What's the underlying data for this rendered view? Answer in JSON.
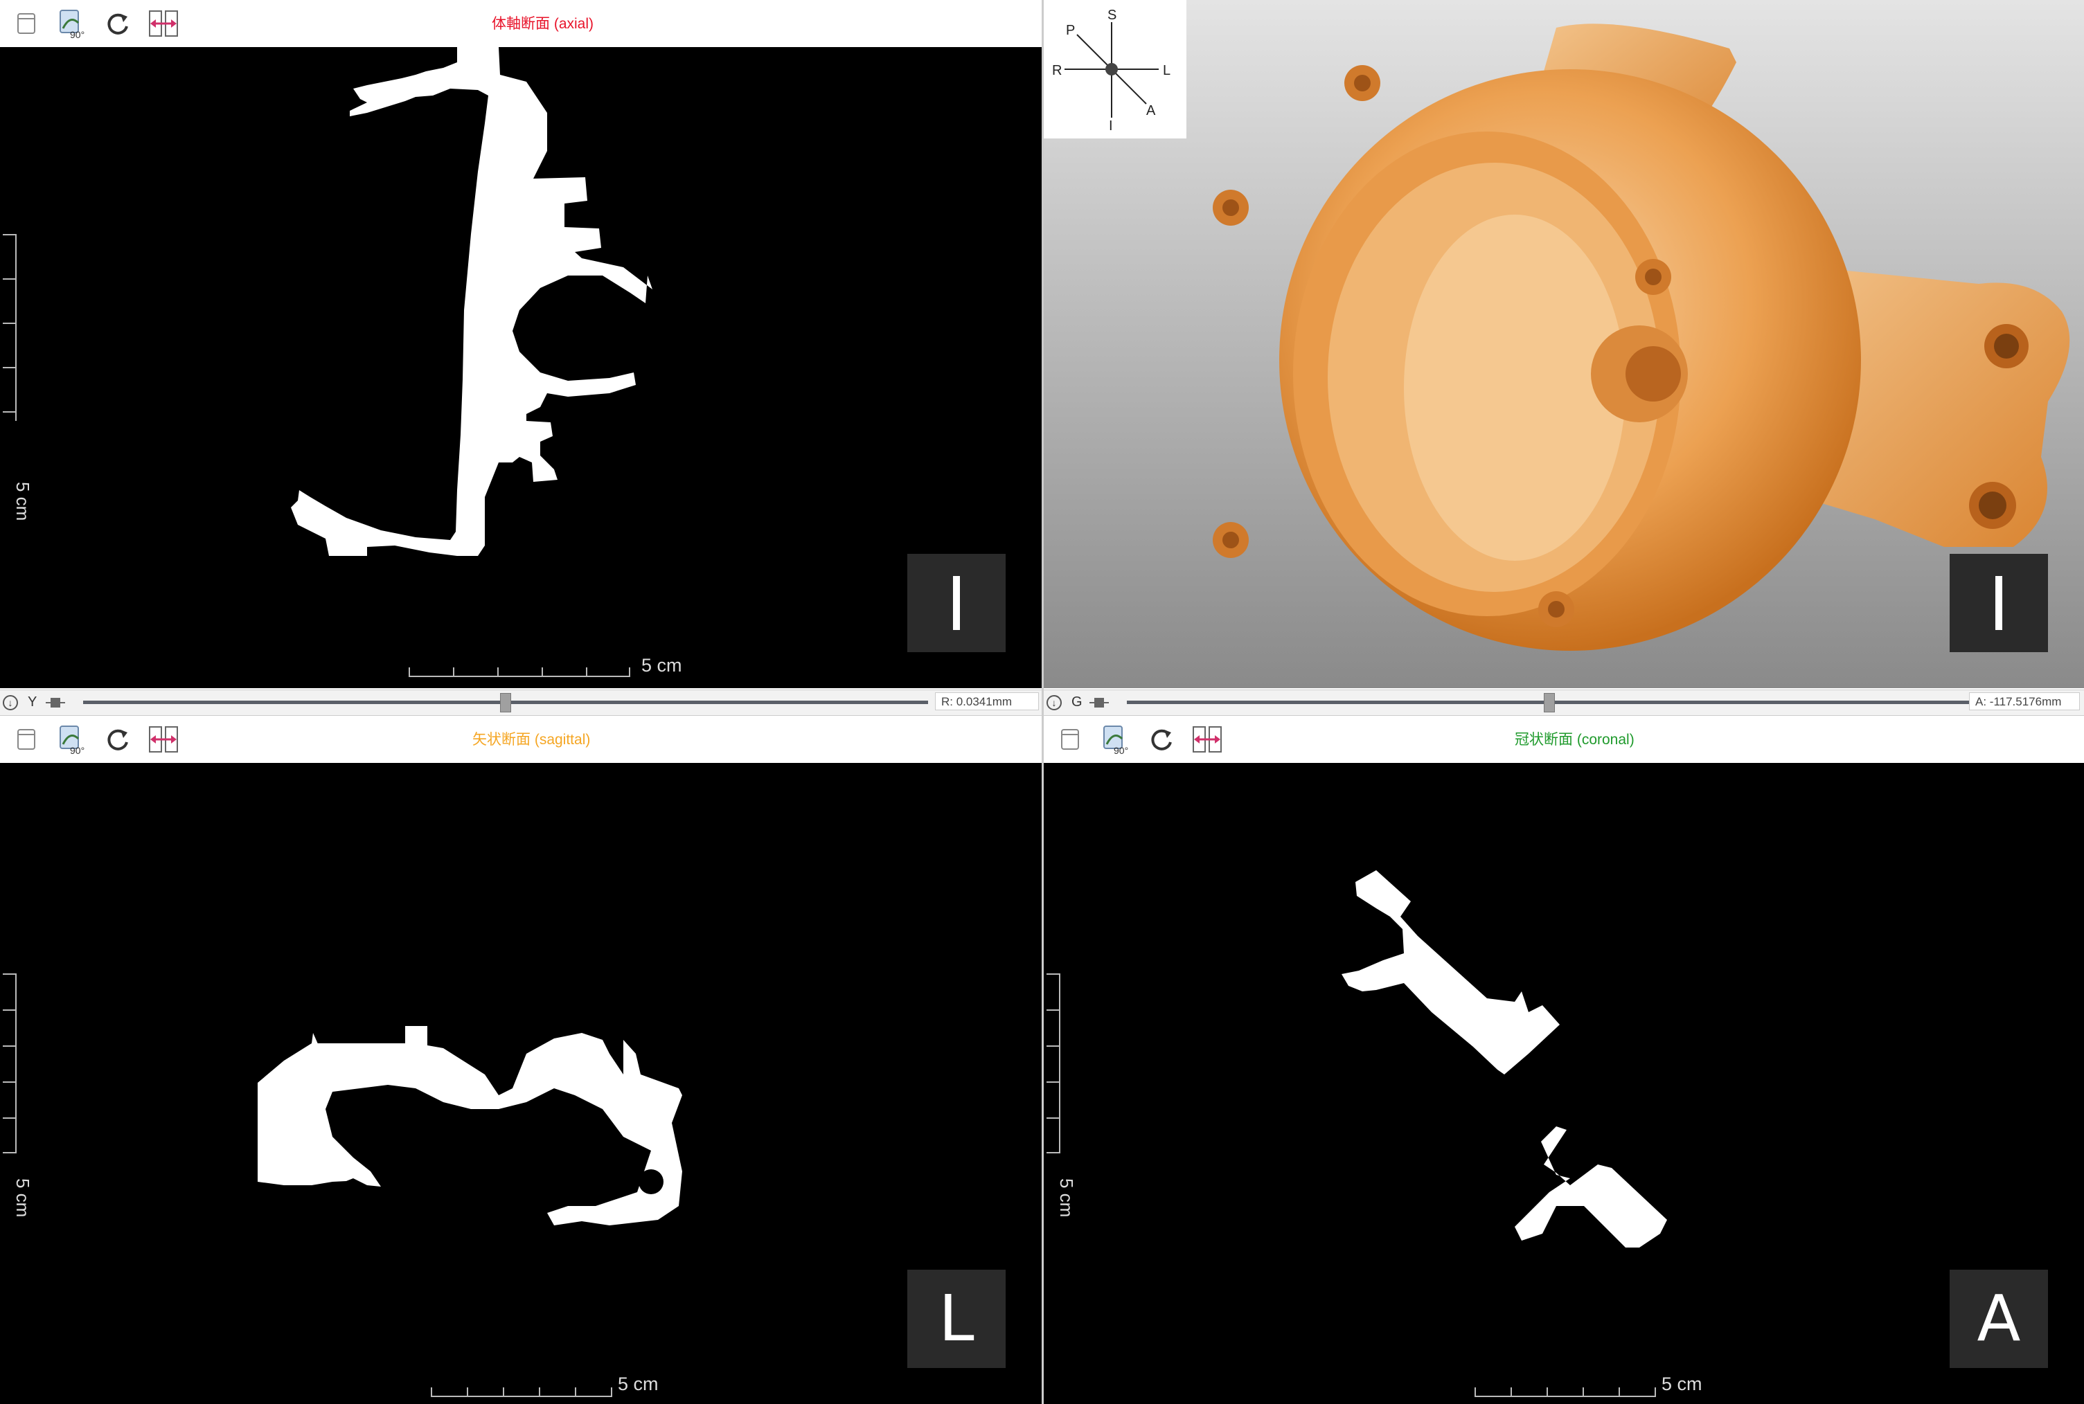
{
  "views": {
    "axial": {
      "title": "体軸断面 (axial)",
      "title_color": "#e8132a",
      "scale_label": "5 cm",
      "orientation": "I"
    },
    "render3d": {
      "orientation": "I"
    },
    "sagittal": {
      "title": "矢状断面 (sagittal)",
      "title_color": "#f5a623",
      "scale_label": "5 cm",
      "orientation": "L"
    },
    "coronal": {
      "title": "冠状断面 (coronal)",
      "title_color": "#1f9a2c",
      "scale_label": "5 cm",
      "orientation": "A"
    }
  },
  "compass": {
    "S": "S",
    "P": "P",
    "R": "R",
    "L": "L",
    "A": "A",
    "I": "I"
  },
  "sliders": {
    "left": {
      "letter": "Y",
      "value": "R: 0.0341mm",
      "fraction": 0.5
    },
    "right": {
      "letter": "G",
      "value": "A: -117.5176mm",
      "fraction": 0.5
    }
  },
  "toolbar": {
    "icons": [
      "window-icon",
      "rotate-90-icon",
      "reset-rotation-icon",
      "flip-horizontal-icon"
    ],
    "rotate_badge": "90°"
  },
  "colors": {
    "render_orange": "#e88a2a",
    "viewport_bg": "#000000"
  }
}
